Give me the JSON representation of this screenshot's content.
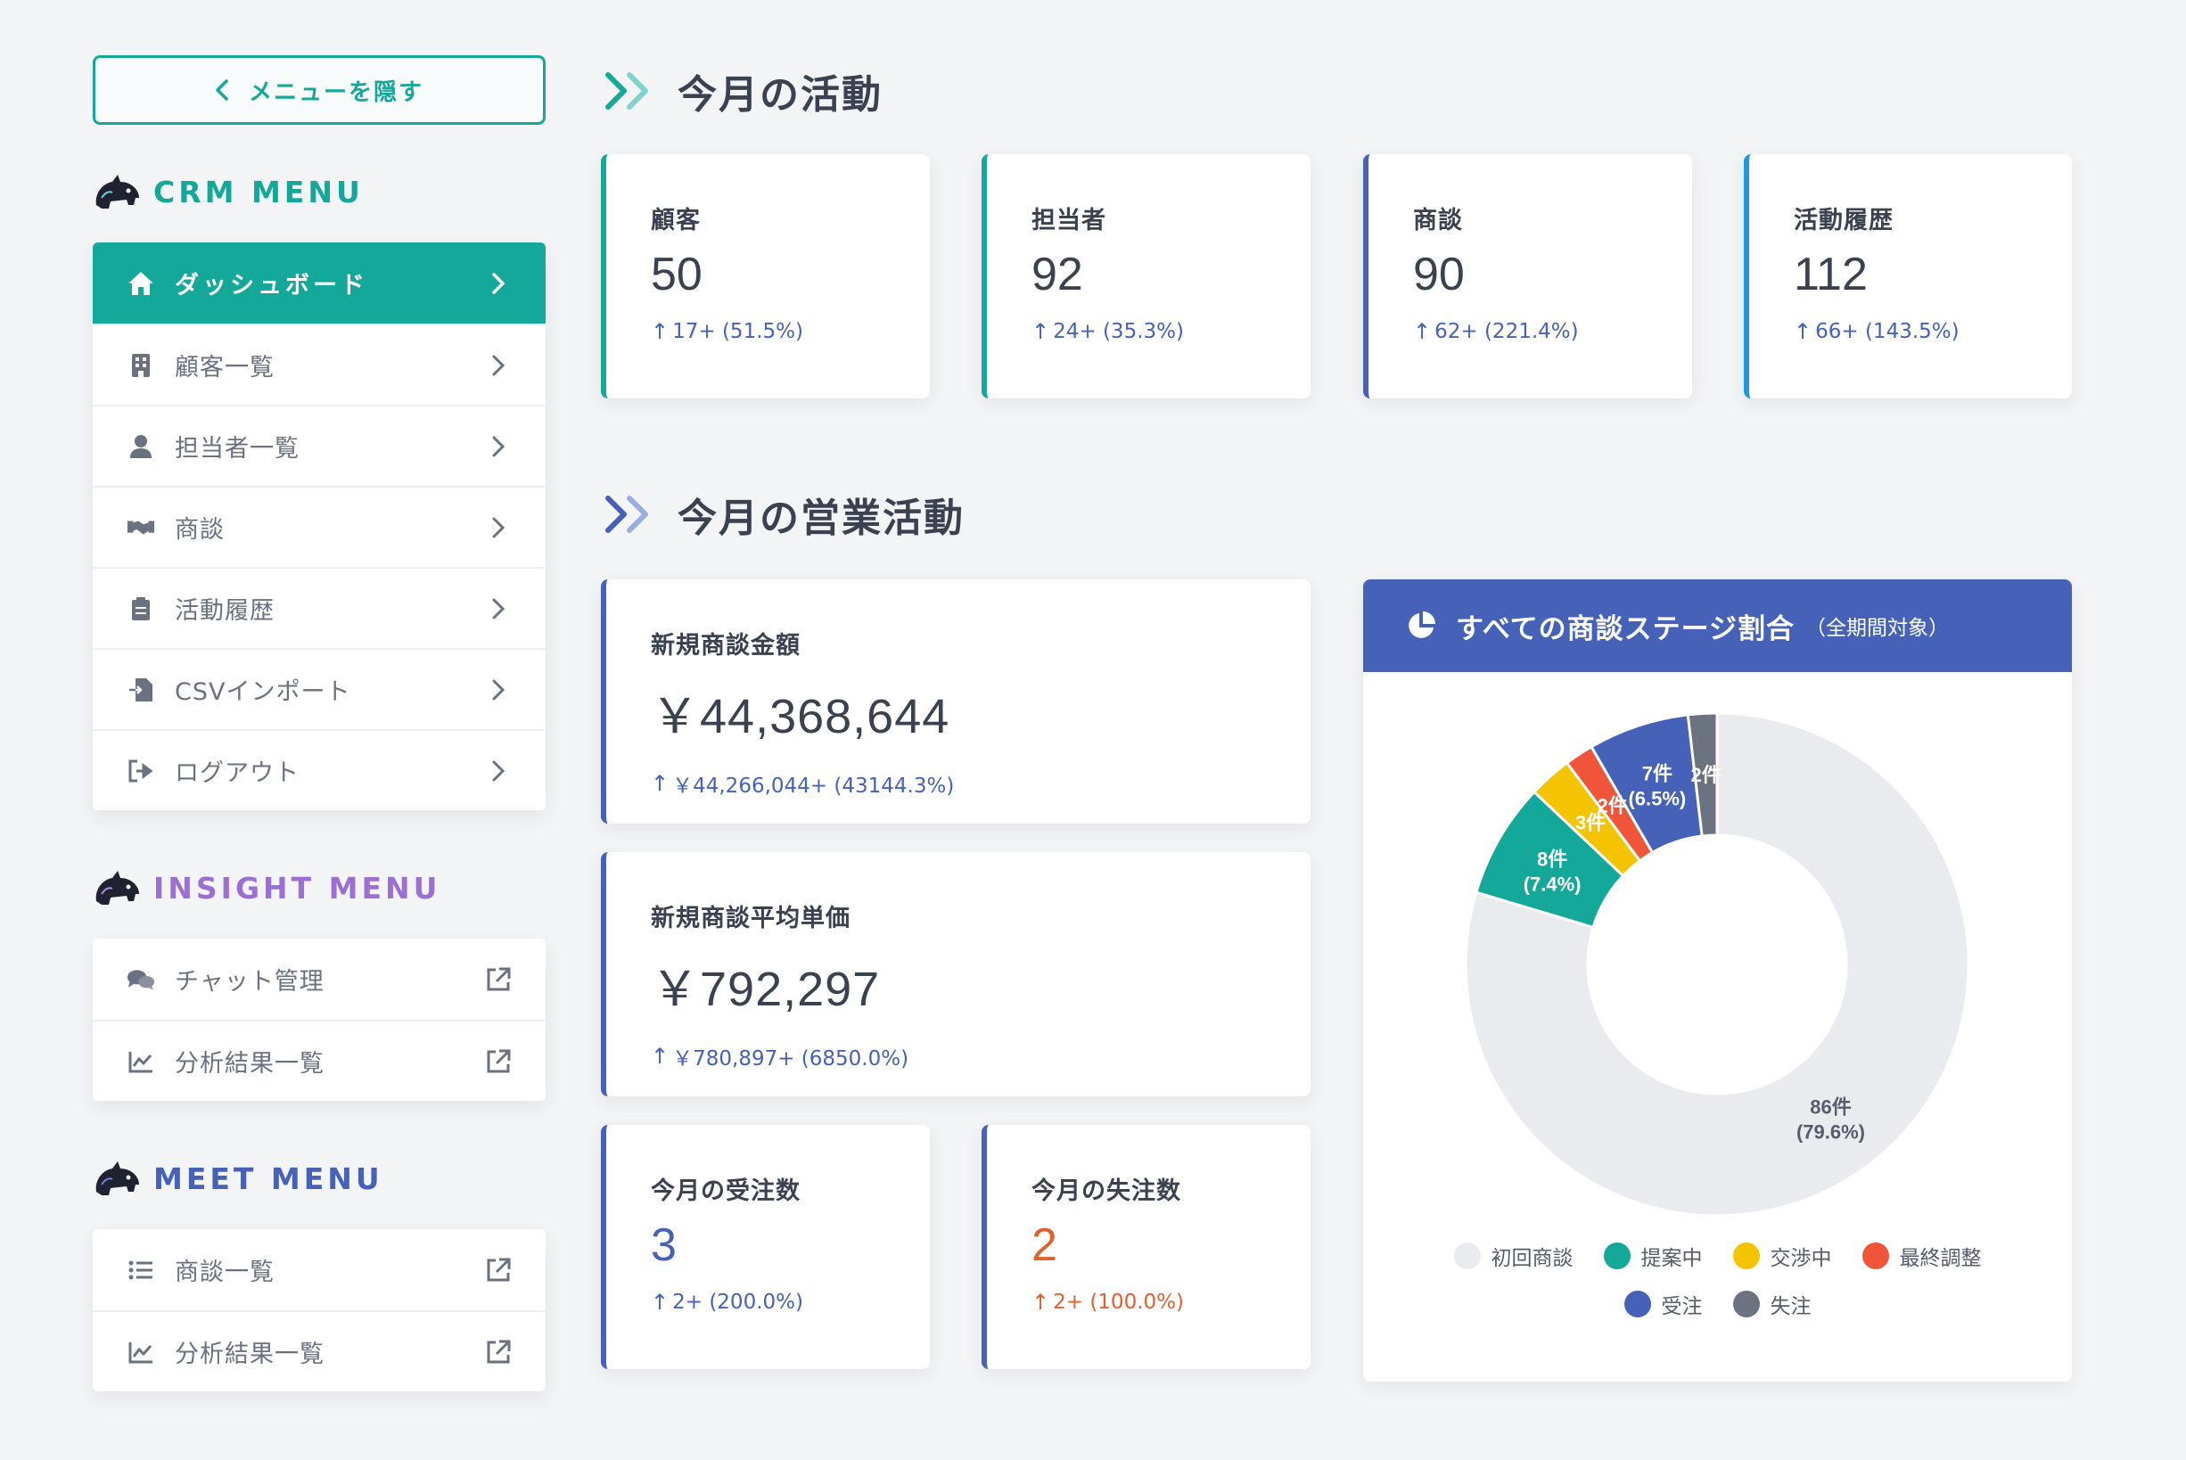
{
  "sidebar": {
    "hide_menu_label": "メニューを隠す",
    "crm_heading": "CRM MENU",
    "insight_heading": "INSIGHT MENU",
    "meet_heading": "MEET MENU",
    "crm_items": [
      {
        "label": "ダッシュボード",
        "icon": "home-icon"
      },
      {
        "label": "顧客一覧",
        "icon": "building-icon"
      },
      {
        "label": "担当者一覧",
        "icon": "user-icon"
      },
      {
        "label": "商談",
        "icon": "handshake-icon"
      },
      {
        "label": "活動履歴",
        "icon": "clipboard-icon"
      },
      {
        "label": "CSVインポート",
        "icon": "file-import-icon"
      },
      {
        "label": "ログアウト",
        "icon": "logout-icon"
      }
    ],
    "insight_items": [
      {
        "label": "チャット管理",
        "icon": "chat-icon"
      },
      {
        "label": "分析結果一覧",
        "icon": "line-chart-icon"
      }
    ],
    "meet_items": [
      {
        "label": "商談一覧",
        "icon": "list-icon"
      },
      {
        "label": "分析結果一覧",
        "icon": "line-chart-icon"
      }
    ]
  },
  "activity": {
    "title": "今月の活動",
    "cards": [
      {
        "label": "顧客",
        "value": "50",
        "delta": "17+ (51.5%)",
        "accent": "#14a89a"
      },
      {
        "label": "担当者",
        "value": "92",
        "delta": "24+ (35.3%)",
        "accent": "#14a89a"
      },
      {
        "label": "商談",
        "value": "90",
        "delta": "62+ (221.4%)",
        "accent": "#4562b8"
      },
      {
        "label": "活動履歴",
        "value": "112",
        "delta": "66+ (143.5%)",
        "accent": "#1e9be0"
      }
    ]
  },
  "sales": {
    "title": "今月の営業活動",
    "new_amount": {
      "label": "新規商談金額",
      "value": "￥44,368,644",
      "delta": "￥44,266,044+ (43144.3%)"
    },
    "avg_price": {
      "label": "新規商談平均単価",
      "value": "￥792,297",
      "delta": "￥780,897+ (6850.0%)"
    },
    "won": {
      "label": "今月の受注数",
      "value": "3",
      "delta": "2+ (200.0%)",
      "color": "#4562b8"
    },
    "lost": {
      "label": "今月の失注数",
      "value": "2",
      "delta": "2+ (100.0%)",
      "color": "#e0602e"
    }
  },
  "pie": {
    "title": "すべての商談ステージ割合",
    "subtitle": "（全期間対象）",
    "icon": "pie-chart-icon"
  },
  "chart_data": {
    "type": "pie",
    "title": "すべての商談ステージ割合",
    "series": [
      {
        "name": "初回商談",
        "value": 86,
        "percent": "79.6%",
        "color": "#e9ebee",
        "count_label": "86件",
        "pct_label": "(79.6%)"
      },
      {
        "name": "提案中",
        "value": 8,
        "percent": "7.4%",
        "color": "#14a89a",
        "count_label": "8件",
        "pct_label": "(7.4%)"
      },
      {
        "name": "交渉中",
        "value": 3,
        "percent": "",
        "color": "#f5c400",
        "count_label": "3件",
        "pct_label": ""
      },
      {
        "name": "最終調整",
        "value": 2,
        "percent": "",
        "color": "#f0553a",
        "count_label": "2件",
        "pct_label": ""
      },
      {
        "name": "受注",
        "value": 7,
        "percent": "6.5%",
        "color": "#4562b8",
        "count_label": "7件",
        "pct_label": "(6.5%)"
      },
      {
        "name": "失注",
        "value": 2,
        "percent": "",
        "color": "#6b7280",
        "count_label": "2件",
        "pct_label": ""
      }
    ],
    "legend_position": "bottom"
  }
}
